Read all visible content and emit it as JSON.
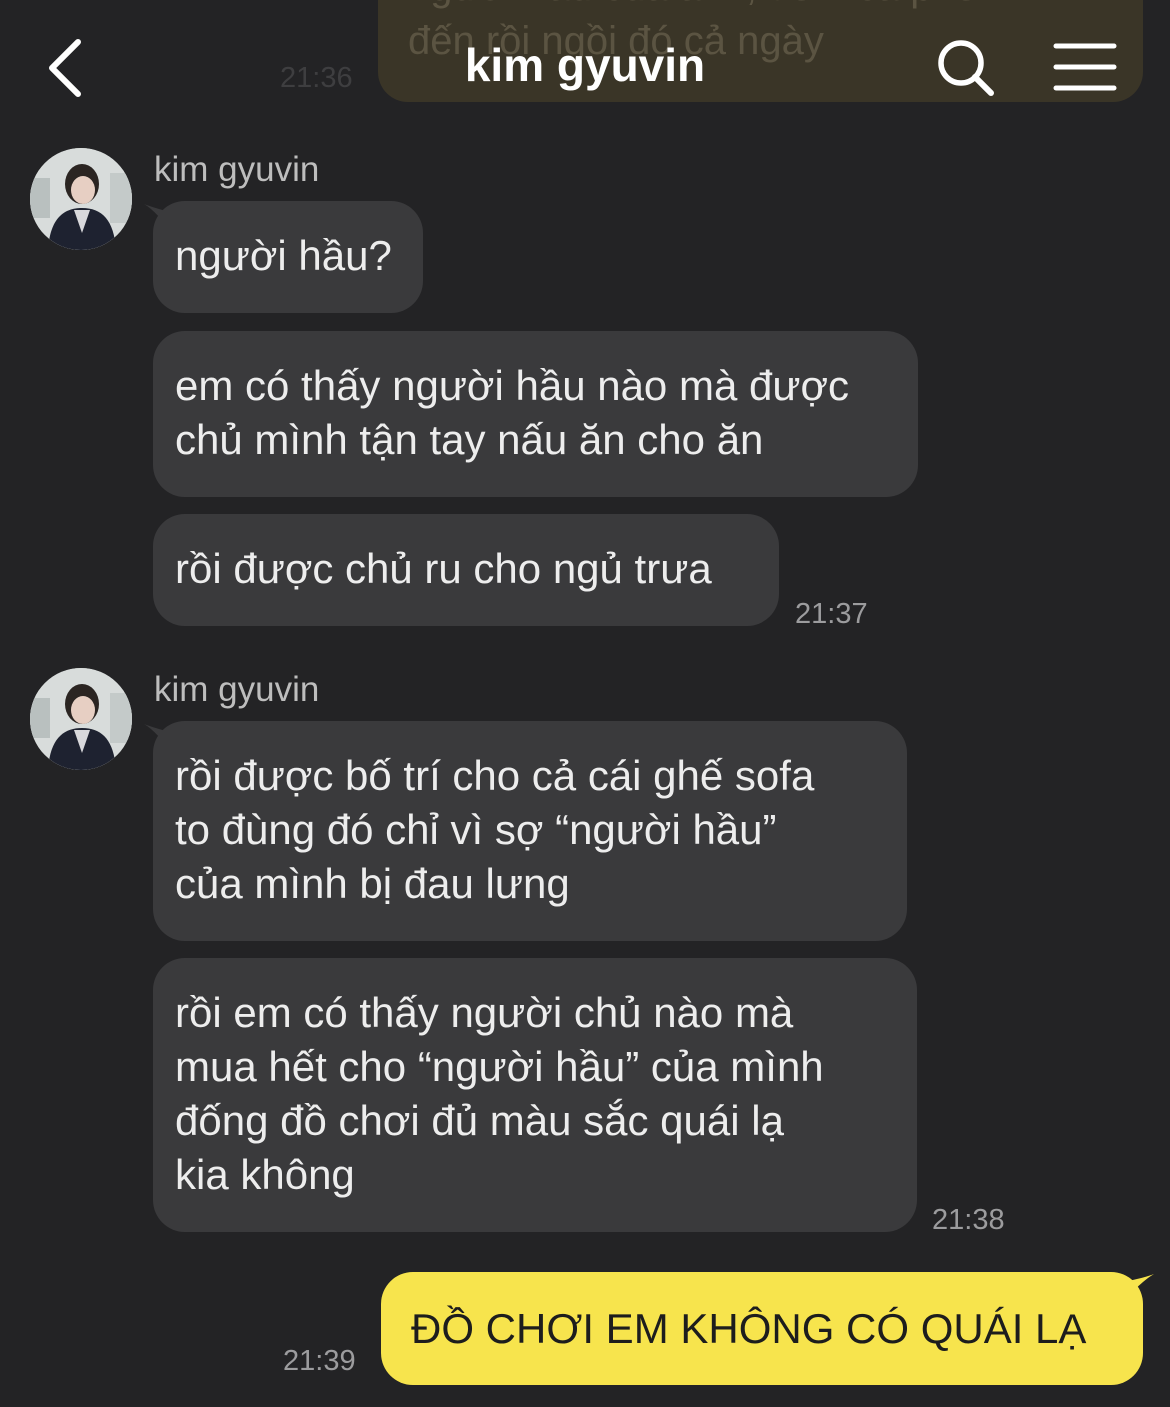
{
  "header": {
    "title": "kim gyuvin"
  },
  "previous_message": {
    "lines": [
      "người hầu của anh, đem cả phê",
      "đến rồi ngồi đó cả ngày"
    ],
    "time": "21:36"
  },
  "groups": [
    {
      "sender": "kim gyuvin",
      "messages": [
        {
          "lines": [
            "người hầu?"
          ]
        },
        {
          "lines": [
            "em có thấy người hầu nào mà được",
            "chủ mình tận tay nấu ăn cho ăn"
          ]
        },
        {
          "lines": [
            "rồi được chủ ru cho ngủ trưa"
          ]
        }
      ],
      "time": "21:37"
    },
    {
      "sender": "kim gyuvin",
      "messages": [
        {
          "lines": [
            "rồi được bố trí cho cả cái ghế sofa",
            "to đùng đó chỉ vì sợ “người hầu”",
            "của mình bị đau lưng"
          ]
        },
        {
          "lines": [
            "rồi em có thấy người chủ nào mà",
            "mua hết cho “người hầu” của mình",
            "đống đồ chơi đủ màu sắc quái lạ",
            "kia không"
          ]
        }
      ],
      "time": "21:38"
    }
  ],
  "outgoing": {
    "text": "ĐỒ CHƠI EM KHÔNG CÓ QUÁI LẠ",
    "time": "21:39"
  },
  "icons": [
    "back-arrow-icon",
    "search-icon",
    "menu-icon",
    "avatar"
  ],
  "colors": {
    "background": "#232325",
    "incoming_bubble": "#3a3a3c",
    "outgoing_bubble": "#f7e44d",
    "timestamp": "#9c9c9e"
  }
}
